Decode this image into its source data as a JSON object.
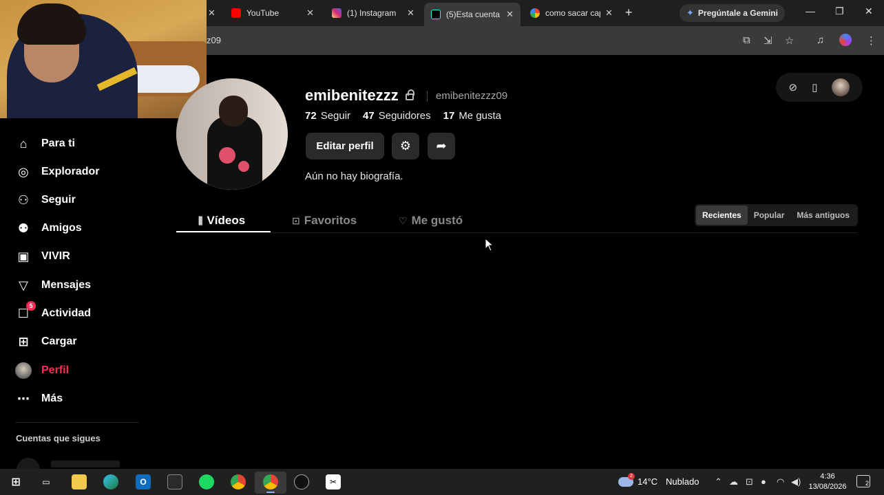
{
  "browser": {
    "tabs": [
      {
        "title": "YouTube",
        "favicon_color": "#ff0000"
      },
      {
        "title": "(1) Instagram",
        "favicon_color": "#d6249f"
      },
      {
        "title": "(5)Esta cuenta",
        "favicon_color": "#000000"
      },
      {
        "title": "como sacar cap",
        "favicon_color": "#4285f4"
      }
    ],
    "active_tab_index": 2,
    "new_tab_label": "+",
    "gemini_label": "Pregúntale a Gemini",
    "url_fragment": "z09"
  },
  "sidebar": {
    "items": [
      {
        "label": "Para ti",
        "icon": "home-icon"
      },
      {
        "label": "Explorador",
        "icon": "compass-icon"
      },
      {
        "label": "Seguir",
        "icon": "user-follow-icon"
      },
      {
        "label": "Amigos",
        "icon": "friends-icon"
      },
      {
        "label": "VIVIR",
        "icon": "live-tv-icon"
      },
      {
        "label": "Mensajes",
        "icon": "send-icon"
      },
      {
        "label": "Actividad",
        "icon": "activity-icon",
        "badge": "5"
      },
      {
        "label": "Cargar",
        "icon": "upload-icon"
      },
      {
        "label": "Perfil",
        "icon": "avatar"
      },
      {
        "label": "Más",
        "icon": "more-icon"
      }
    ],
    "active_item": "Perfil",
    "section_title": "Cuentas que sigues",
    "accent_color": "#ff2b55"
  },
  "profile": {
    "display_name": "emibenitezzz",
    "username": "emibenitezzz09",
    "stats": [
      {
        "value": "72",
        "label": "Seguir"
      },
      {
        "value": "47",
        "label": "Seguidores"
      },
      {
        "value": "17",
        "label": "Me gusta"
      }
    ],
    "edit_button": "Editar perfil",
    "bio": "Aún no hay biografía."
  },
  "content_tabs": [
    {
      "label": "Vídeos",
      "icon": "grid-icon"
    },
    {
      "label": "Favoritos",
      "icon": "bookmark-icon"
    },
    {
      "label": "Me gustó",
      "icon": "heart-icon"
    }
  ],
  "sort": {
    "options": [
      "Recientes",
      "Popular",
      "Más antiguos"
    ],
    "selected": "Recientes"
  },
  "taskbar": {
    "weather_temp": "14°C",
    "weather_text": "Nublado",
    "weather_badge": "2",
    "time": "4:36",
    "date": "13/08/2026",
    "notification_count": "2"
  }
}
